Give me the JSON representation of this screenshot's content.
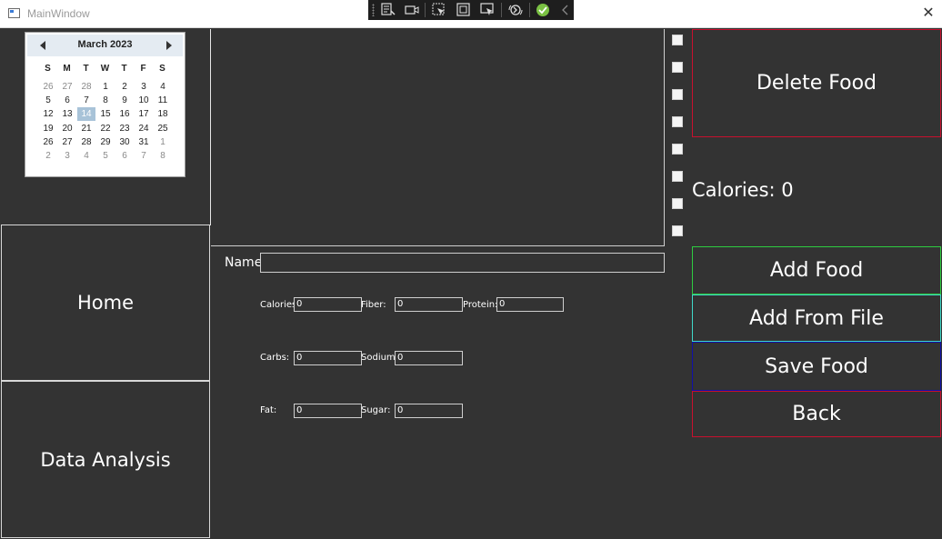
{
  "window": {
    "title": "MainWindow"
  },
  "calendar": {
    "month_label": "March 2023",
    "days_of_week": [
      "S",
      "M",
      "T",
      "W",
      "T",
      "F",
      "S"
    ],
    "weeks": [
      [
        "26",
        "27",
        "28",
        "1",
        "2",
        "3",
        "4"
      ],
      [
        "5",
        "6",
        "7",
        "8",
        "9",
        "10",
        "11"
      ],
      [
        "12",
        "13",
        "14",
        "15",
        "16",
        "17",
        "18"
      ],
      [
        "19",
        "20",
        "21",
        "22",
        "23",
        "24",
        "25"
      ],
      [
        "26",
        "27",
        "28",
        "29",
        "30",
        "31",
        "1"
      ],
      [
        "2",
        "3",
        "4",
        "5",
        "6",
        "7",
        "8"
      ]
    ],
    "selected_day": "14"
  },
  "nav": {
    "home_label": "Home",
    "analysis_label": "Data Analysis"
  },
  "form": {
    "name_label": "Name:",
    "name_value": "",
    "calories_label": "Calories:",
    "calories_value": "0",
    "fiber_label": "Fiber:",
    "fiber_value": "0",
    "protein_label": "Protein:",
    "protein_value": "0",
    "carbs_label": "Carbs:",
    "carbs_value": "0",
    "sodium_label": "Sodium:",
    "sodium_value": "0",
    "fat_label": "Fat:",
    "fat_value": "0",
    "sugar_label": "Sugar:",
    "sugar_value": "0"
  },
  "actions": {
    "delete_label": "Delete Food",
    "calories_total": "Calories: 0",
    "add_label": "Add Food",
    "add_file_label": "Add From File",
    "save_label": "Save Food",
    "back_label": "Back"
  },
  "colors": {
    "background": "#333333",
    "delete_border": "#c8102e",
    "add_border": "#2ecc40",
    "add_file_border": "#3fd8c8",
    "save_border": "#1010a8",
    "back_border": "#c8102e"
  }
}
